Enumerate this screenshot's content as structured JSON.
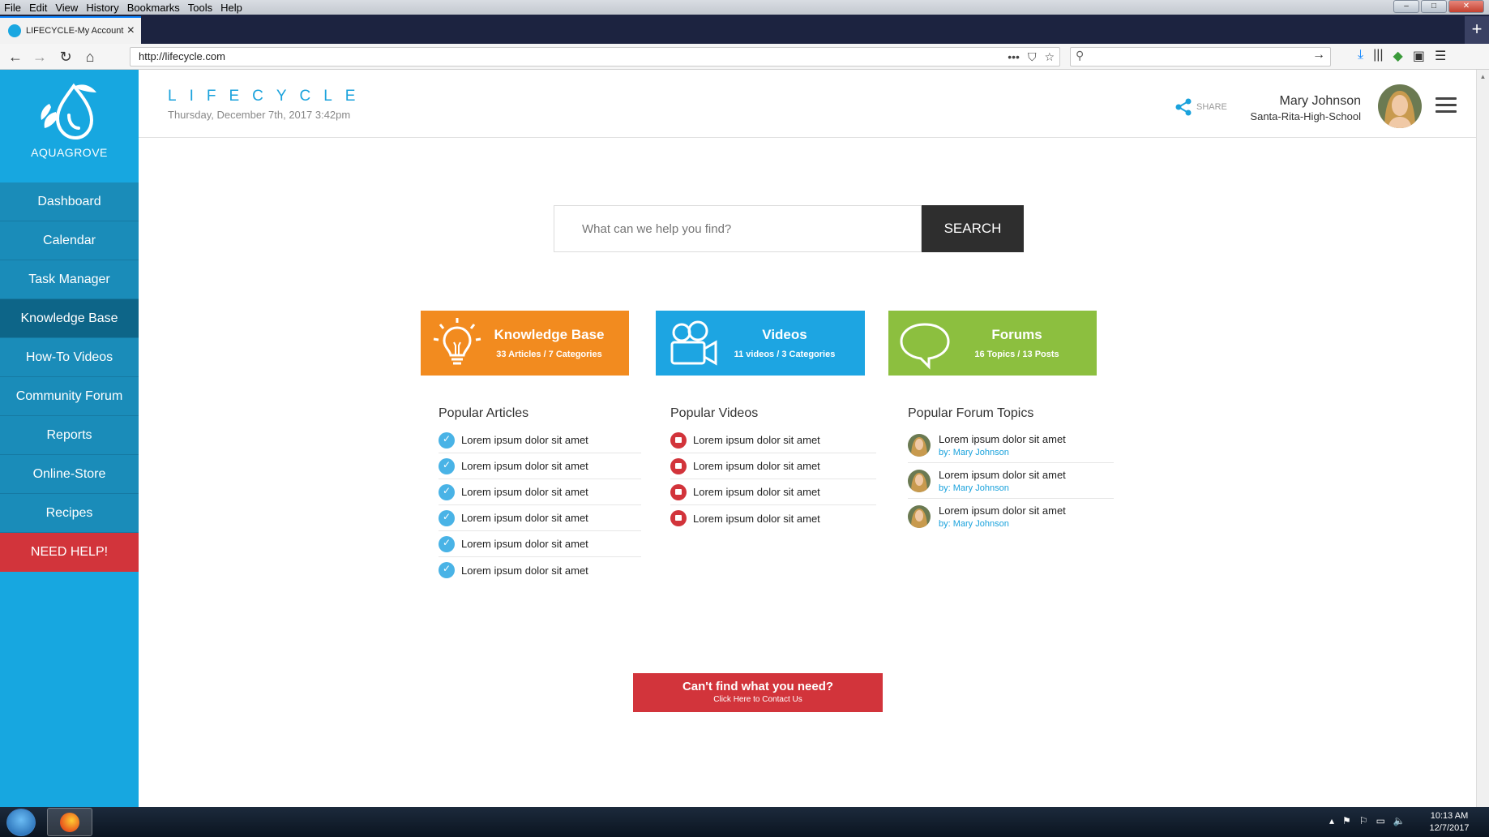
{
  "browser": {
    "menu": [
      "File",
      "Edit",
      "View",
      "History",
      "Bookmarks",
      "Tools",
      "Help"
    ],
    "tab_title": "LIFECYCLE-My Account",
    "url": "http://lifecycle.com"
  },
  "sidebar": {
    "logo_text": "AQUAGROVE",
    "items": [
      {
        "label": "Dashboard"
      },
      {
        "label": "Calendar"
      },
      {
        "label": "Task Manager"
      },
      {
        "label": "Knowledge Base"
      },
      {
        "label": "How-To Videos"
      },
      {
        "label": "Community Forum"
      },
      {
        "label": "Reports"
      },
      {
        "label": "Online-Store"
      },
      {
        "label": "Recipes"
      },
      {
        "label": "NEED HELP!"
      }
    ]
  },
  "header": {
    "brand": "LIFECYCLE",
    "datetime": "Thursday, December 7th, 2017  3:42pm",
    "share_label": "SHARE",
    "user_name": "Mary Johnson",
    "user_school": "Santa-Rita-High-School"
  },
  "search": {
    "placeholder": "What can we help you find?",
    "button_label": "SEARCH"
  },
  "cards": {
    "knowledge_base": {
      "title": "Knowledge Base",
      "subtitle": "33 Articles / 7 Categories"
    },
    "videos": {
      "title": "Videos",
      "subtitle": "11 videos / 3 Categories"
    },
    "forums": {
      "title": "Forums",
      "subtitle": "16 Topics / 13 Posts"
    }
  },
  "popular_articles": {
    "title": "Popular Articles",
    "items": [
      "Lorem ipsum dolor sit amet",
      "Lorem ipsum dolor sit amet",
      "Lorem ipsum dolor sit amet",
      "Lorem ipsum dolor sit amet",
      "Lorem ipsum dolor sit amet",
      "Lorem ipsum dolor sit amet"
    ]
  },
  "popular_videos": {
    "title": "Popular Videos",
    "items": [
      "Lorem ipsum dolor sit amet",
      "Lorem ipsum dolor sit amet",
      "Lorem ipsum dolor sit amet",
      "Lorem ipsum dolor sit amet"
    ]
  },
  "popular_forum_topics": {
    "title": "Popular Forum Topics",
    "items": [
      {
        "title": "Lorem ipsum dolor sit amet",
        "author": "by: Mary Johnson"
      },
      {
        "title": "Lorem ipsum dolor sit amet",
        "author": "by: Mary Johnson"
      },
      {
        "title": "Lorem ipsum dolor sit amet",
        "author": "by: Mary Johnson"
      }
    ]
  },
  "contact": {
    "main": "Can't find what you need?",
    "sub": "Click Here to Contact Us"
  },
  "taskbar": {
    "time": "10:13 AM",
    "date": "12/7/2017"
  },
  "colors": {
    "sidebar": "#17a7e0",
    "nav_item": "#1a8cb9",
    "nav_active": "#0d6588",
    "help": "#d2343b",
    "knowledge_base_card": "#f28b1f",
    "videos_card": "#1da5e2",
    "forums_card": "#8cbf3f"
  }
}
